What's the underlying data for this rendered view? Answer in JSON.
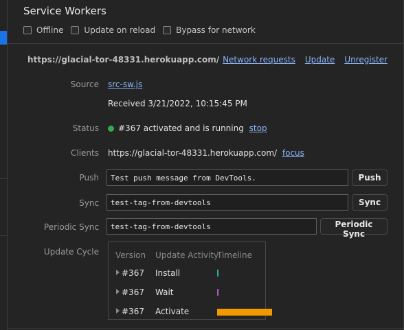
{
  "header": {
    "title": "Service Workers",
    "options": [
      {
        "label": "Offline",
        "checked": false
      },
      {
        "label": "Update on reload",
        "checked": false
      },
      {
        "label": "Bypass for network",
        "checked": false
      }
    ]
  },
  "worker": {
    "scope": "https://glacial-tor-48331.herokuapp.com/",
    "links": {
      "network": "Network requests",
      "update": "Update",
      "unregister": "Unregister"
    },
    "source": {
      "label": "Source",
      "file": "src-sw.js",
      "received": "Received 3/21/2022, 10:15:45 PM"
    },
    "status": {
      "label": "Status",
      "text": "#367 activated and is running",
      "action": "stop",
      "color": "#34a853"
    },
    "clients": {
      "label": "Clients",
      "url": "https://glacial-tor-48331.herokuapp.com/",
      "action": "focus"
    },
    "push": {
      "label": "Push",
      "value": "Test push message from DevTools.",
      "button": "Push"
    },
    "sync": {
      "label": "Sync",
      "value": "test-tag-from-devtools",
      "button": "Sync"
    },
    "periodic_sync": {
      "label": "Periodic Sync",
      "value": "test-tag-from-devtools",
      "button": "Periodic Sync"
    },
    "update_cycle": {
      "label": "Update Cycle",
      "headers": [
        "Version",
        "Update Activity",
        "Timeline"
      ],
      "rows": [
        {
          "version": "#367",
          "activity": "Install",
          "color": "#1fb5ad"
        },
        {
          "version": "#367",
          "activity": "Wait",
          "color": "#b15ac7"
        },
        {
          "version": "#367",
          "activity": "Activate",
          "color": "#f29900"
        }
      ]
    }
  }
}
